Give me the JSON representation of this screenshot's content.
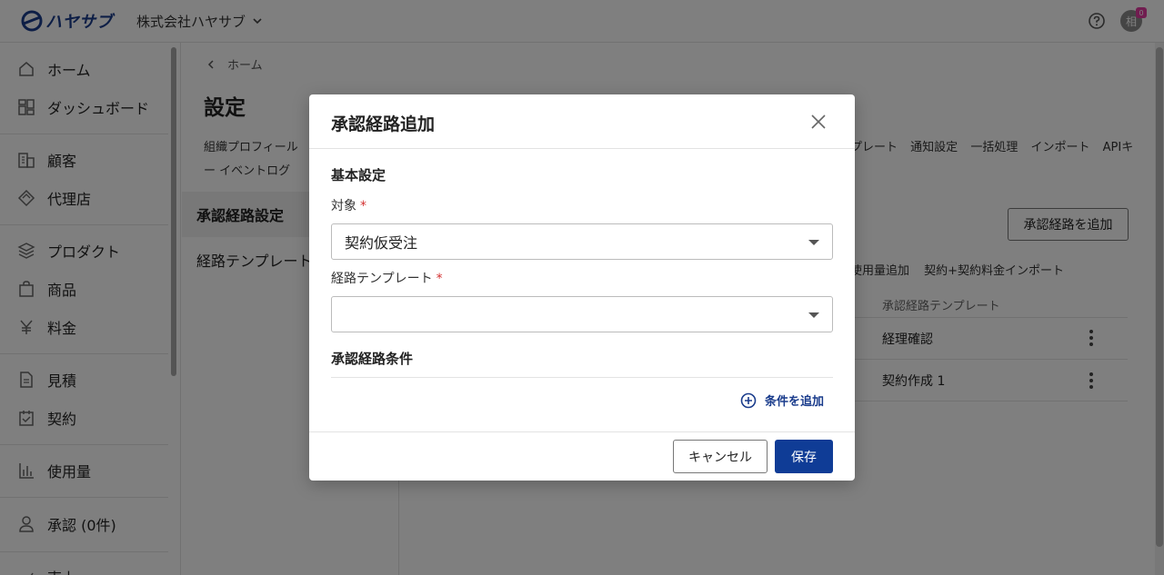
{
  "header": {
    "logo_text": "ハヤサブ",
    "org_name": "株式会社ハヤサブ",
    "avatar_text": "相",
    "avatar_badge": "0"
  },
  "sidebar": {
    "items": [
      {
        "label": "ホーム",
        "icon": "home-icon"
      },
      {
        "label": "ダッシュボード",
        "icon": "dashboard-icon"
      },
      {
        "label": "顧客",
        "icon": "customer-icon"
      },
      {
        "label": "代理店",
        "icon": "agency-icon"
      },
      {
        "label": "プロダクト",
        "icon": "product-icon"
      },
      {
        "label": "商品",
        "icon": "bag-icon"
      },
      {
        "label": "料金",
        "icon": "yen-icon"
      },
      {
        "label": "見積",
        "icon": "document-icon"
      },
      {
        "label": "契約",
        "icon": "contract-icon"
      },
      {
        "label": "使用量",
        "icon": "usage-icon"
      },
      {
        "label": "承認 (0件)",
        "icon": "user-icon"
      },
      {
        "label": "売上",
        "icon": "sales-icon"
      }
    ]
  },
  "main": {
    "breadcrumb": "ホーム",
    "page_title": "設定",
    "tabs_line1_left": "組織プロフィール",
    "tabs_line1_right": [
      "プレート",
      "通知設定",
      "一括処理",
      "インポート",
      "APIキ"
    ],
    "tabs_line2": "ー  イベントログ",
    "subnav": [
      "承認経路設定",
      "経路テンプレート"
    ],
    "add_route_button": "承認経路を追加",
    "content_tabs": [
      "使用量追加",
      "契約+契約料金インポート"
    ],
    "table_header": "承認経路テンプレート",
    "table_rows": [
      "経理確認",
      "契約作成 1"
    ]
  },
  "modal": {
    "title": "承認経路追加",
    "section_basic": "基本設定",
    "target_label": "対象",
    "target_value": "契約仮受注",
    "template_label": "経路テンプレート",
    "template_value": "",
    "required_mark": "*",
    "section_conditions": "承認経路条件",
    "add_condition": "条件を追加",
    "cancel_label": "キャンセル",
    "save_label": "保存"
  },
  "colors": {
    "brand": "#1a3c8c",
    "primary_button": "#0f3c96",
    "required": "#d32f2f"
  }
}
